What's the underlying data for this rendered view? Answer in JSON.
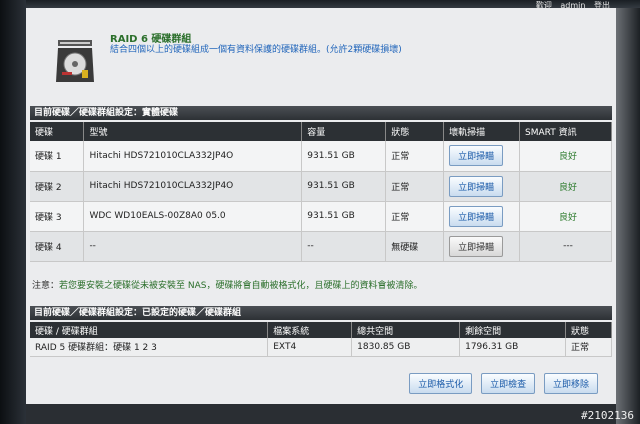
{
  "top_bar": {
    "welcome": "歡迎",
    "user": "admin",
    "logout": "登出"
  },
  "header": {
    "title": "RAID 6 硬碟群組",
    "description": "結合四個以上的硬碟組成一個有資料保護的硬碟群組。(允許2顆硬碟損壞)"
  },
  "physical_section": {
    "title": "目前硬碟／硬碟群組設定：實體硬碟",
    "columns": [
      "硬碟",
      "型號",
      "容量",
      "狀態",
      "壞軌掃描",
      "SMART 資訊"
    ],
    "rows": [
      {
        "disk": "硬碟 1",
        "model": "Hitachi HDS721010CLA332JP4O",
        "capacity": "931.51 GB",
        "status": "正常",
        "scan": "立即掃瞄",
        "smart": "良好"
      },
      {
        "disk": "硬碟 2",
        "model": "Hitachi HDS721010CLA332JP4O",
        "capacity": "931.51 GB",
        "status": "正常",
        "scan": "立即掃瞄",
        "smart": "良好"
      },
      {
        "disk": "硬碟 3",
        "model": "WDC WD10EALS-00Z8A0 05.0",
        "capacity": "931.51 GB",
        "status": "正常",
        "scan": "立即掃瞄",
        "smart": "良好"
      },
      {
        "disk": "硬碟 4",
        "model": "--",
        "capacity": "--",
        "status": "無硬碟",
        "scan": "立即掃瞄",
        "smart": "---"
      }
    ]
  },
  "note": {
    "label": "注意：",
    "text": "若您要安裝之硬碟從未被安裝至 NAS，硬碟將會自動被格式化，且硬碟上的資料會被清除。"
  },
  "group_section": {
    "title": "目前硬碟／硬碟群組設定：已設定的硬碟／硬碟群組",
    "columns": [
      "硬碟 / 硬碟群組",
      "檔案系統",
      "總共空間",
      "剩餘空間",
      "狀態"
    ],
    "rows": [
      {
        "group": "RAID 5 硬碟群組：硬碟 1 2 3",
        "fs": "EXT4",
        "total": "1830.85 GB",
        "free": "1796.31 GB",
        "status": "正常"
      }
    ]
  },
  "actions": {
    "format": "立即格式化",
    "check": "立即檢查",
    "remove": "立即移除"
  },
  "watermark": "#2102136",
  "colors": {
    "section_bar": "#2d3135",
    "accent_blue": "#2266bb",
    "status_green": "#2b7a2b"
  }
}
